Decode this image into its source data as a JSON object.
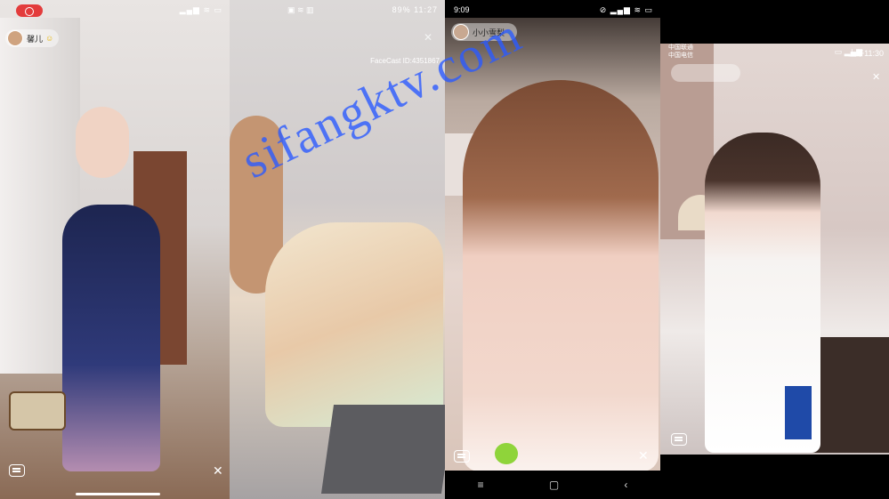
{
  "panels": [
    {
      "host": "馨儿",
      "has_record_indicator": true
    },
    {
      "time": "11:27",
      "battery": "89%",
      "overlay_id": "FaceCast ID:4351867"
    },
    {
      "time": "9:09",
      "host": "小小雪梨"
    },
    {
      "carrier1": "中国联通",
      "carrier2": "中国电信",
      "time": "上午11:30"
    }
  ],
  "watermark": "sifangktv.com",
  "colors": {
    "record": "#e33c3c",
    "watermark": "#2c5bff"
  },
  "icons": [
    "record-icon",
    "chat-icon",
    "close-icon",
    "home-indicator",
    "nav-menu-icon",
    "nav-home-icon",
    "nav-back-icon",
    "leaf-icon"
  ]
}
